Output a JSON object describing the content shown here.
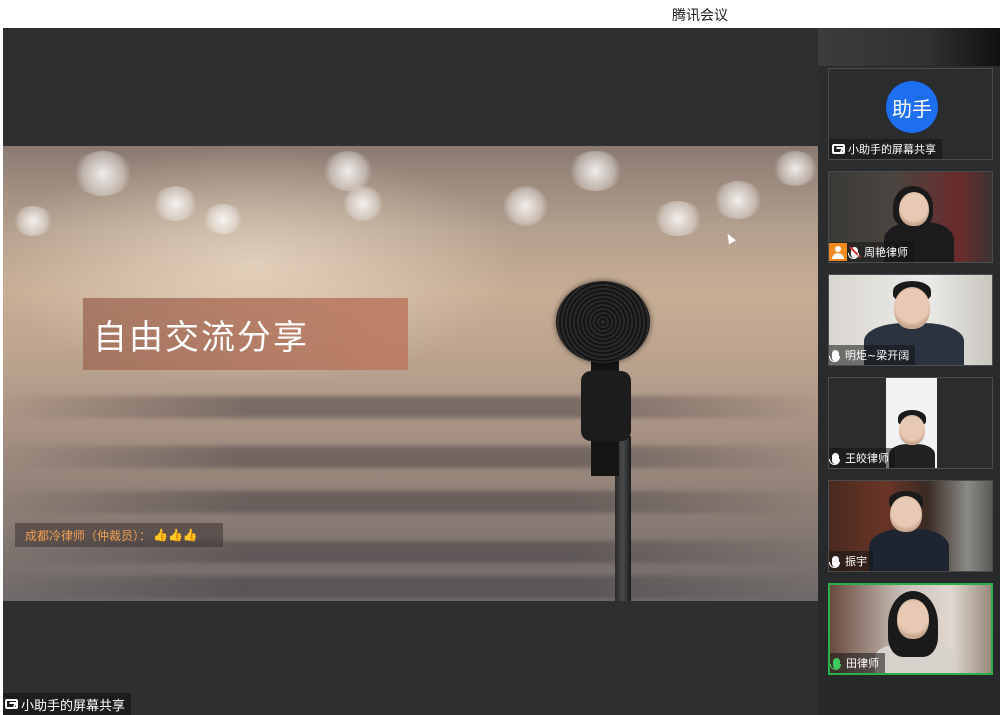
{
  "window": {
    "title": "腾讯会议"
  },
  "shared_screen": {
    "slide_title": "自由交流分享",
    "chat_message": "成都冷律师（仲裁员）：",
    "chat_reactions": "👍👍👍",
    "share_label": "小助手的屏幕共享"
  },
  "participants": [
    {
      "name": "小助手的屏幕共享",
      "avatar_text": "助手",
      "avatar_color": "#1e6ef0",
      "status": "screen-share"
    },
    {
      "name": "周艳律师",
      "status": "host-muted"
    },
    {
      "name": "明炬~梁开阔",
      "status": "mic"
    },
    {
      "name": "王皎律师",
      "status": "mic"
    },
    {
      "name": "振宇",
      "status": "mic"
    },
    {
      "name": "田律师",
      "status": "speaking"
    }
  ],
  "colors": {
    "speaking": "#2bb14a",
    "accent": "#1e6ef0",
    "host_badge": "#f08a1e",
    "chat_text": "#f0a050"
  }
}
